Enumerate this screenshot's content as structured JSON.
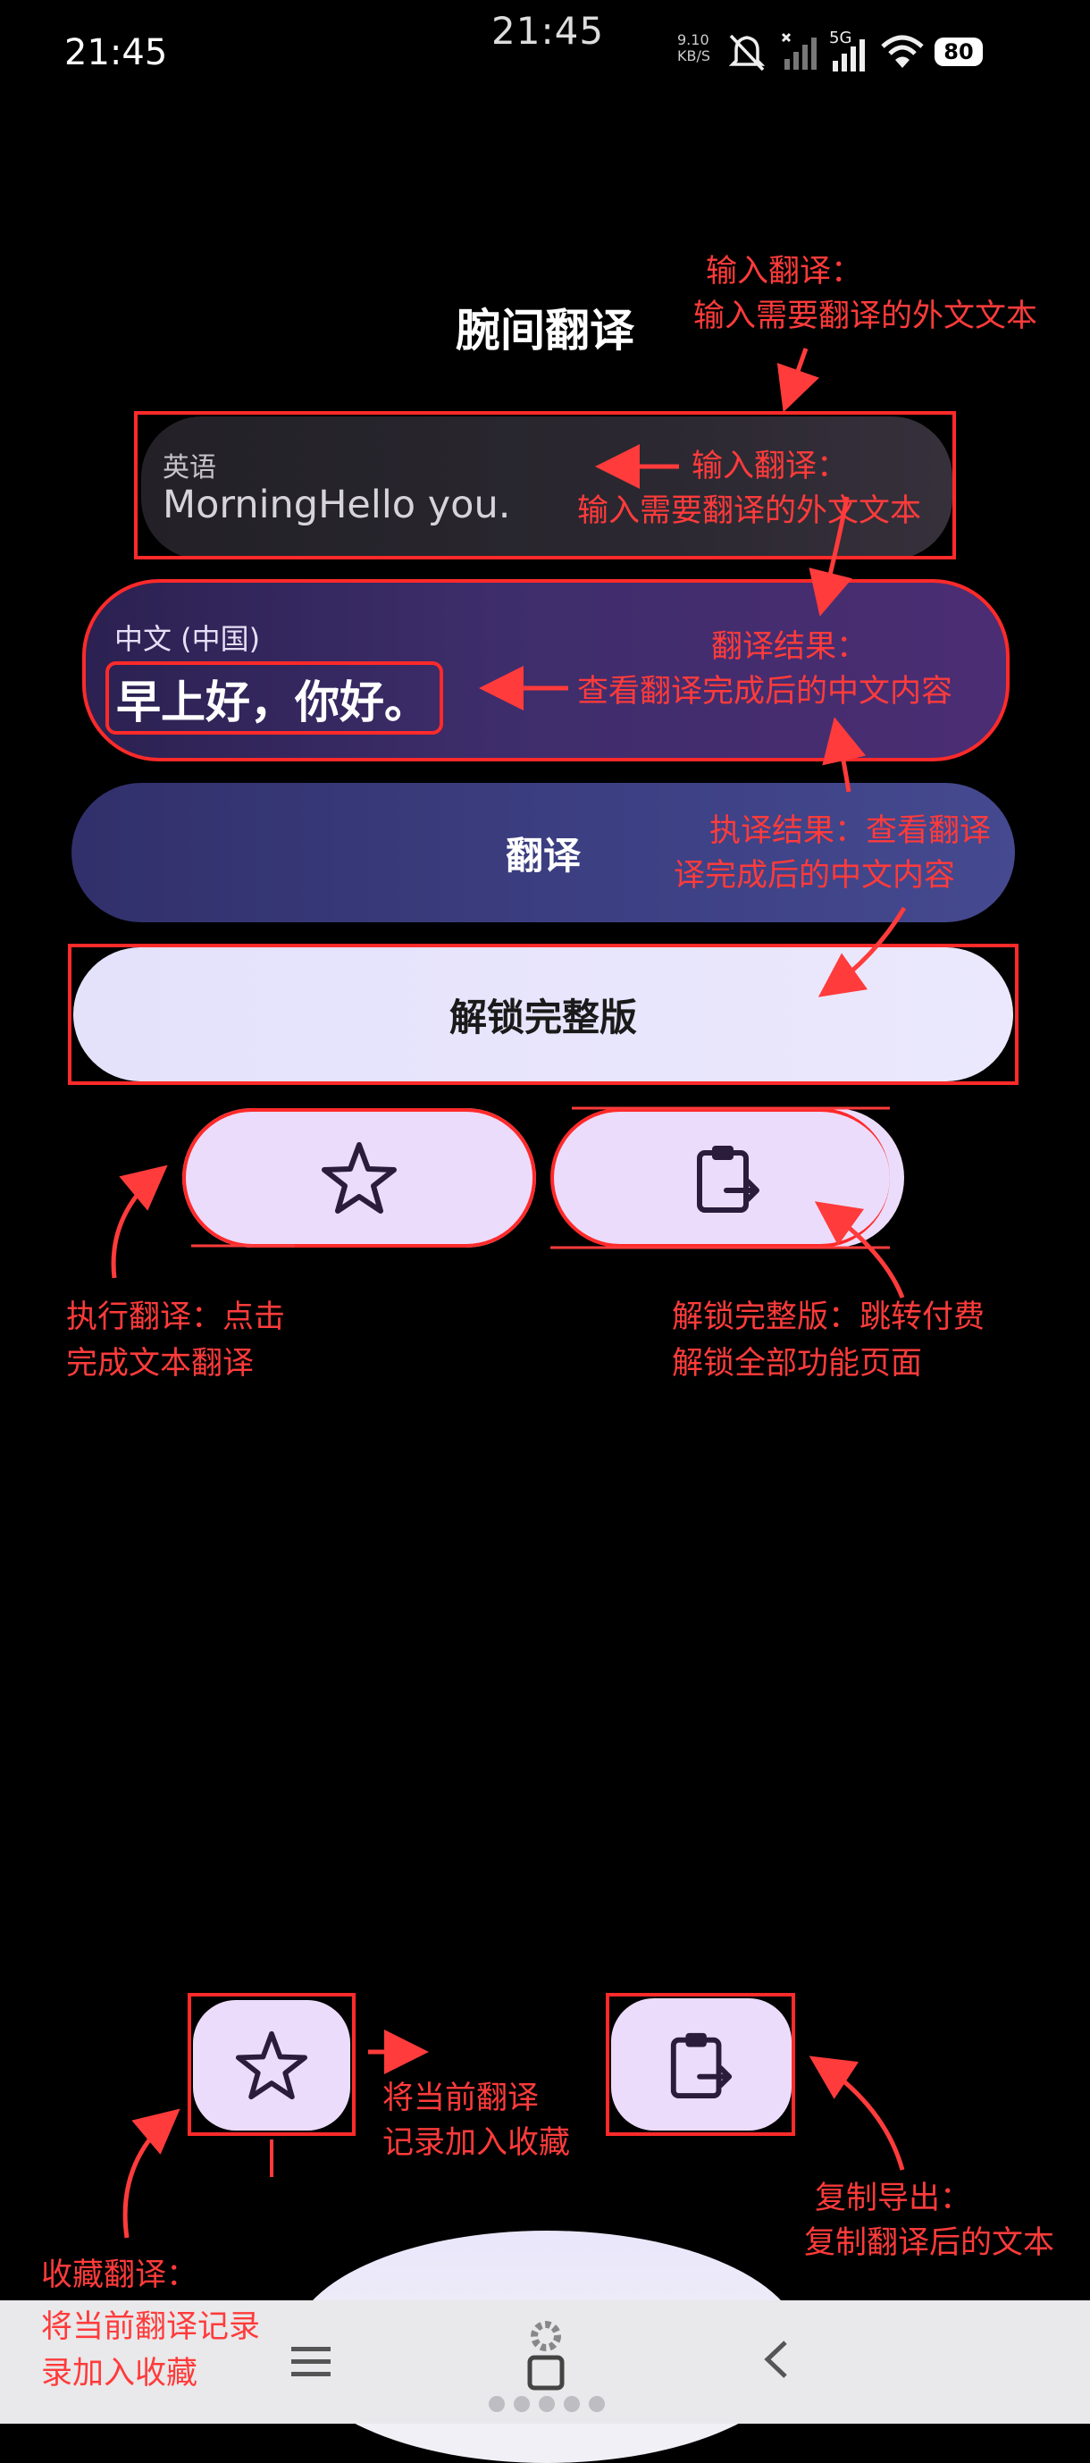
{
  "status_bar": {
    "time_left": "21:45",
    "time_center": "21:45",
    "speed": "9.10\nKB/S",
    "signal_label": "5G",
    "battery": "80"
  },
  "app": {
    "title": "腕间翻译"
  },
  "input_card": {
    "language": "英语",
    "text": "MorningHello you."
  },
  "result_card": {
    "language": "中文 (中国)",
    "text": "早上好，你好。"
  },
  "buttons": {
    "translate": "翻译",
    "unlock": "解锁完整版"
  },
  "annotations": {
    "top_input_title": "输入翻译：",
    "top_input_desc": "输入需要翻译的外文文本",
    "card_input_title": "输入翻译：",
    "card_input_desc": "输入需要翻译的外文文本",
    "result_title": "翻译结果：",
    "result_desc": "查看翻译完成后的中文内容",
    "exec_result_line1": "执译结果：查看翻译",
    "exec_result_line2": "译完成后的中文内容",
    "exec_translate_line1": "执行翻译：点击",
    "exec_translate_line2": "完成文本翻译",
    "unlock_line1": "解锁完整版：跳转付费",
    "unlock_line2": "解锁全部功能页面",
    "add_fav_line1": "将当前翻译",
    "add_fav_line2": "记录加入收藏",
    "copy_export_line1": "复制导出：",
    "copy_export_line2": "复制翻译后的文本",
    "fav_title": "收藏翻译：",
    "fav_line1": "将当前翻译记录",
    "fav_line2": "录加入收藏"
  },
  "colors": {
    "annotation": "#ff3b3b",
    "accent_purple": "#3e2d6b",
    "pill_bg": "#ecdcfb"
  },
  "icons": [
    "star-icon",
    "clipboard-export-icon",
    "gear-icon",
    "menu-icon",
    "home-icon",
    "back-icon"
  ]
}
